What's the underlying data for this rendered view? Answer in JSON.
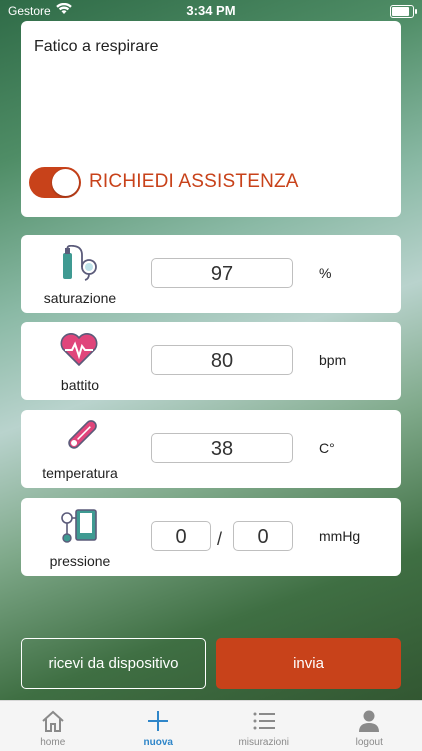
{
  "status_bar": {
    "carrier": "Gestore",
    "time": "3:34 PM"
  },
  "symptom": {
    "text": "Fatico a respirare",
    "assist_label": "RICHIEDI ASSISTENZA",
    "assist_enabled": true
  },
  "measurements": [
    {
      "label": "saturazione",
      "value": "97",
      "unit": "%",
      "icon": "oxygen-icon"
    },
    {
      "label": "battito",
      "value": "80",
      "unit": "bpm",
      "icon": "heart-rate-icon"
    },
    {
      "label": "temperatura",
      "value": "38",
      "unit": "C°",
      "icon": "thermometer-icon"
    },
    {
      "label": "pressione",
      "systolic": "0",
      "diastolic": "0",
      "separator": "/",
      "unit": "mmHg",
      "icon": "blood-pressure-icon"
    }
  ],
  "buttons": {
    "device": "ricevi da dispositivo",
    "send": "invia"
  },
  "tabs": [
    {
      "label": "home",
      "icon": "home-icon"
    },
    {
      "label": "nuova",
      "icon": "plus-icon",
      "active": true
    },
    {
      "label": "misurazioni",
      "icon": "list-icon"
    },
    {
      "label": "logout",
      "icon": "user-icon"
    }
  ],
  "colors": {
    "accent": "#c8421a",
    "icon_teal": "#3f9a92",
    "icon_pink": "#e0457b",
    "tab_active": "#2f86c9"
  }
}
